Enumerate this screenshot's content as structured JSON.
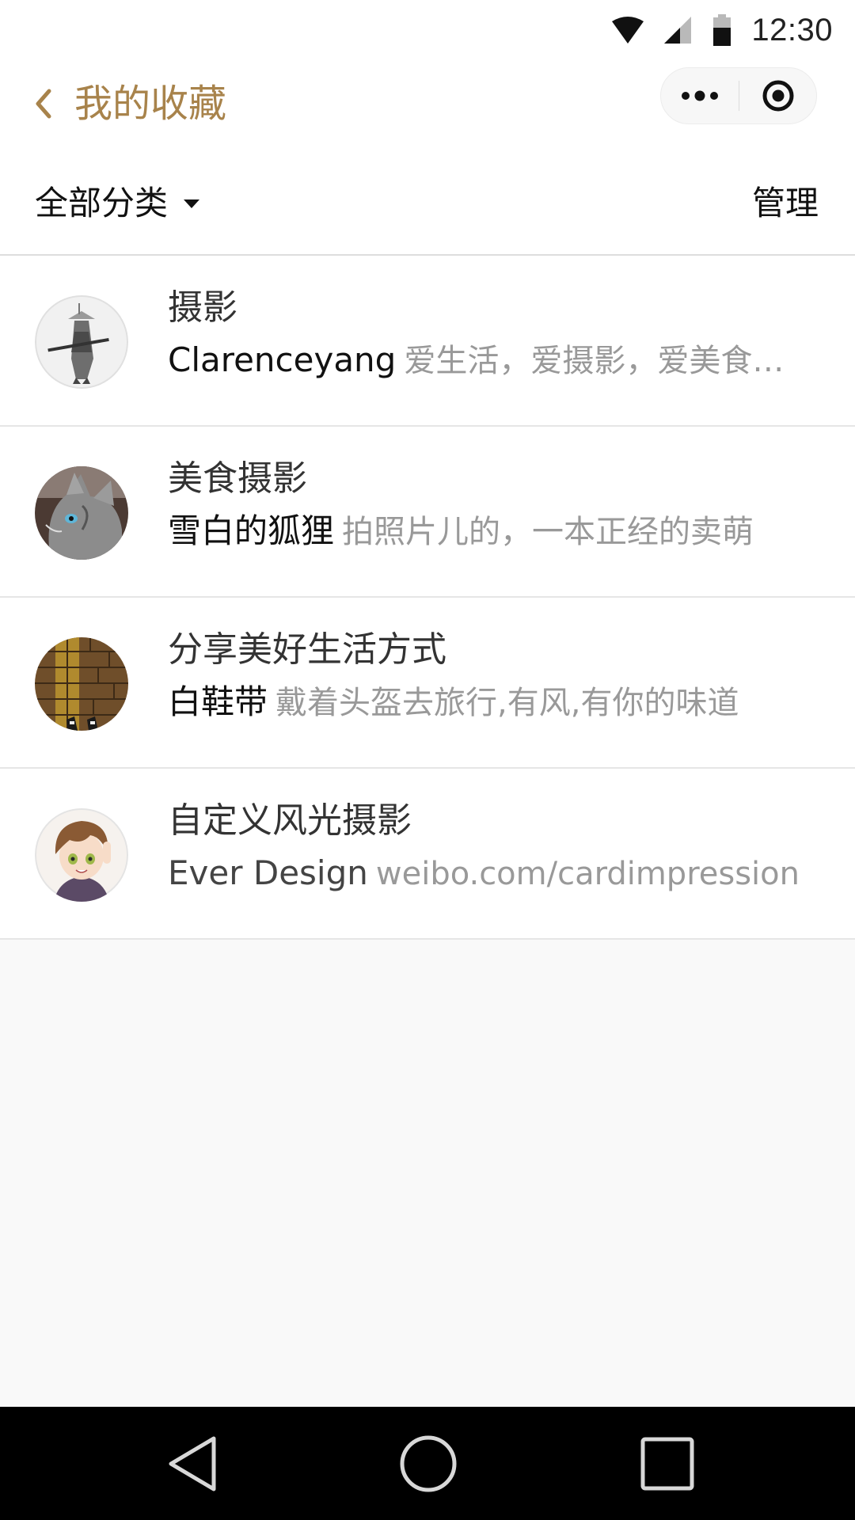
{
  "status_bar": {
    "time": "12:30",
    "icons": [
      "wifi-icon",
      "cell-signal-icon",
      "battery-icon"
    ]
  },
  "title_bar": {
    "back_icon": "chevron-left-icon",
    "title": "我的收藏",
    "capsule_icons": [
      "more-dots-icon",
      "close-target-icon"
    ]
  },
  "filter_bar": {
    "category_label": "全部分类",
    "dropdown_icon": "caret-down-icon",
    "manage_label": "管理"
  },
  "favorites": [
    {
      "title": "摄影",
      "author": "Clarenceyang",
      "description": "爱生活，爱摄影，爱美食…",
      "avatar": "samurai-avatar"
    },
    {
      "title": "美食摄影",
      "author": "雪白的狐狸",
      "description": "拍照片儿的，一本正经的卖萌",
      "avatar": "cat-avatar"
    },
    {
      "title": "分享美好生活方式",
      "author": "白鞋带",
      "description": "戴着头盔去旅行,有风,有你的味道",
      "avatar": "bricks-shoes-avatar"
    },
    {
      "title": "自定义风光摄影",
      "author": "Ever Design",
      "description": "weibo.com/cardimpression",
      "avatar": "anime-boy-avatar"
    }
  ],
  "nav_bar": {
    "icons": [
      "nav-back-icon",
      "nav-home-icon",
      "nav-recents-icon"
    ]
  },
  "colors": {
    "accent": "#a8834b",
    "description_gray": "#999999",
    "background": "#f9f9f9",
    "nav_bar": "#000000"
  }
}
